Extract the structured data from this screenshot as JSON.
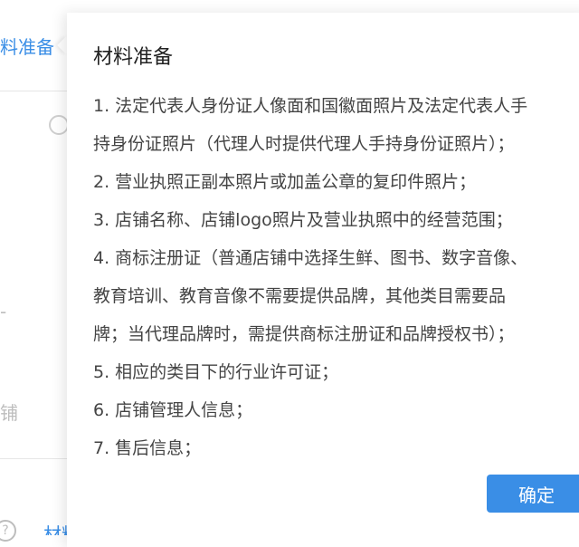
{
  "background": {
    "tab_label": "料准备",
    "side_char_1": "-",
    "side_char_2": "铺",
    "help_icon_glyph": "?",
    "bottom_link": "材料说明"
  },
  "popover": {
    "title": "材料准备",
    "items": [
      "1. 法定代表人身份证人像面和国徽面照片及法定代表人手\n持身份证照片（代理人时提供代理人手持身份证照片）；",
      "2. 营业执照正副本照片或加盖公章的复印件照片；",
      "3. 店铺名称、店铺logo照片及营业执照中的经营范围；",
      "4. 商标注册证（普通店铺中选择生鲜、图书、数字音像、\n教育培训、教育音像不需要提供品牌，其他类目需要品\n牌；当代理品牌时，需提供商标注册证和品牌授权书）；",
      "5. 相应的类目下的行业许可证；",
      "6. 店铺管理人信息；",
      "7. 售后信息；"
    ],
    "confirm_label": "确定"
  },
  "colors": {
    "accent": "#3a8ee6",
    "text": "#444444",
    "title": "#222222"
  }
}
